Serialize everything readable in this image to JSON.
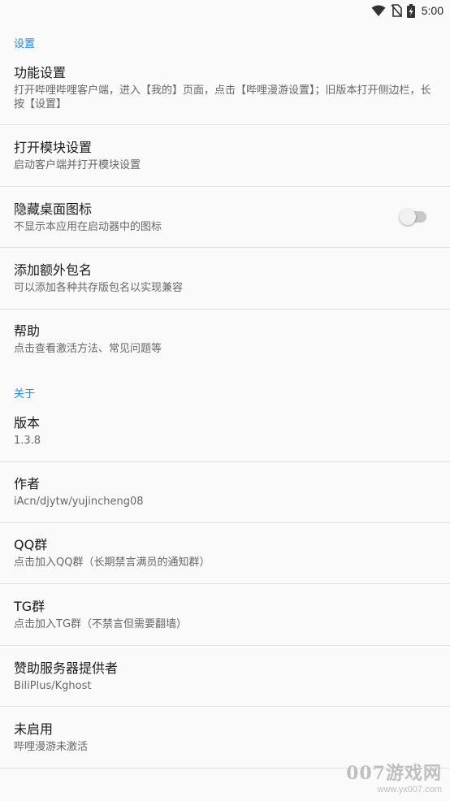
{
  "status_bar": {
    "time": "5:00",
    "icons": [
      "wifi-icon",
      "no-sim-icon",
      "battery-charging-icon"
    ]
  },
  "sections": {
    "settings_header": "设置",
    "about_header": "关于"
  },
  "items": {
    "feature_settings": {
      "title": "功能设置",
      "summary": "打开哔哩哔哩客户端，进入【我的】页面，点击【哔哩漫游设置】；旧版本打开侧边栏，长按【设置】"
    },
    "open_module": {
      "title": "打开模块设置",
      "summary": "启动客户端并打开模块设置"
    },
    "hide_icon": {
      "title": "隐藏桌面图标",
      "summary": "不显示本应用在启动器中的图标",
      "toggle_on": false
    },
    "extra_package": {
      "title": "添加额外包名",
      "summary": "可以添加各种共存版包名以实现兼容"
    },
    "help": {
      "title": "帮助",
      "summary": "点击查看激活方法、常见问题等"
    },
    "version": {
      "title": "版本",
      "summary": "1.3.8"
    },
    "author": {
      "title": "作者",
      "summary": "iAcn/djytw/yujincheng08"
    },
    "qq_group": {
      "title": "QQ群",
      "summary": "点击加入QQ群（长期禁言满员的通知群）"
    },
    "tg_group": {
      "title": "TG群",
      "summary": "点击加入TG群（不禁言但需要翻墙）"
    },
    "sponsor": {
      "title": "赞助服务器提供者",
      "summary": "BiliPlus/Kghost"
    },
    "activation": {
      "title": "未启用",
      "summary": "哔哩漫游未激活"
    }
  },
  "watermark": {
    "main": "007游戏网",
    "url": "www.yx007.com"
  },
  "colors": {
    "accent": "#1e88e5",
    "background": "#fafafa",
    "divider": "#e0e0e0"
  }
}
